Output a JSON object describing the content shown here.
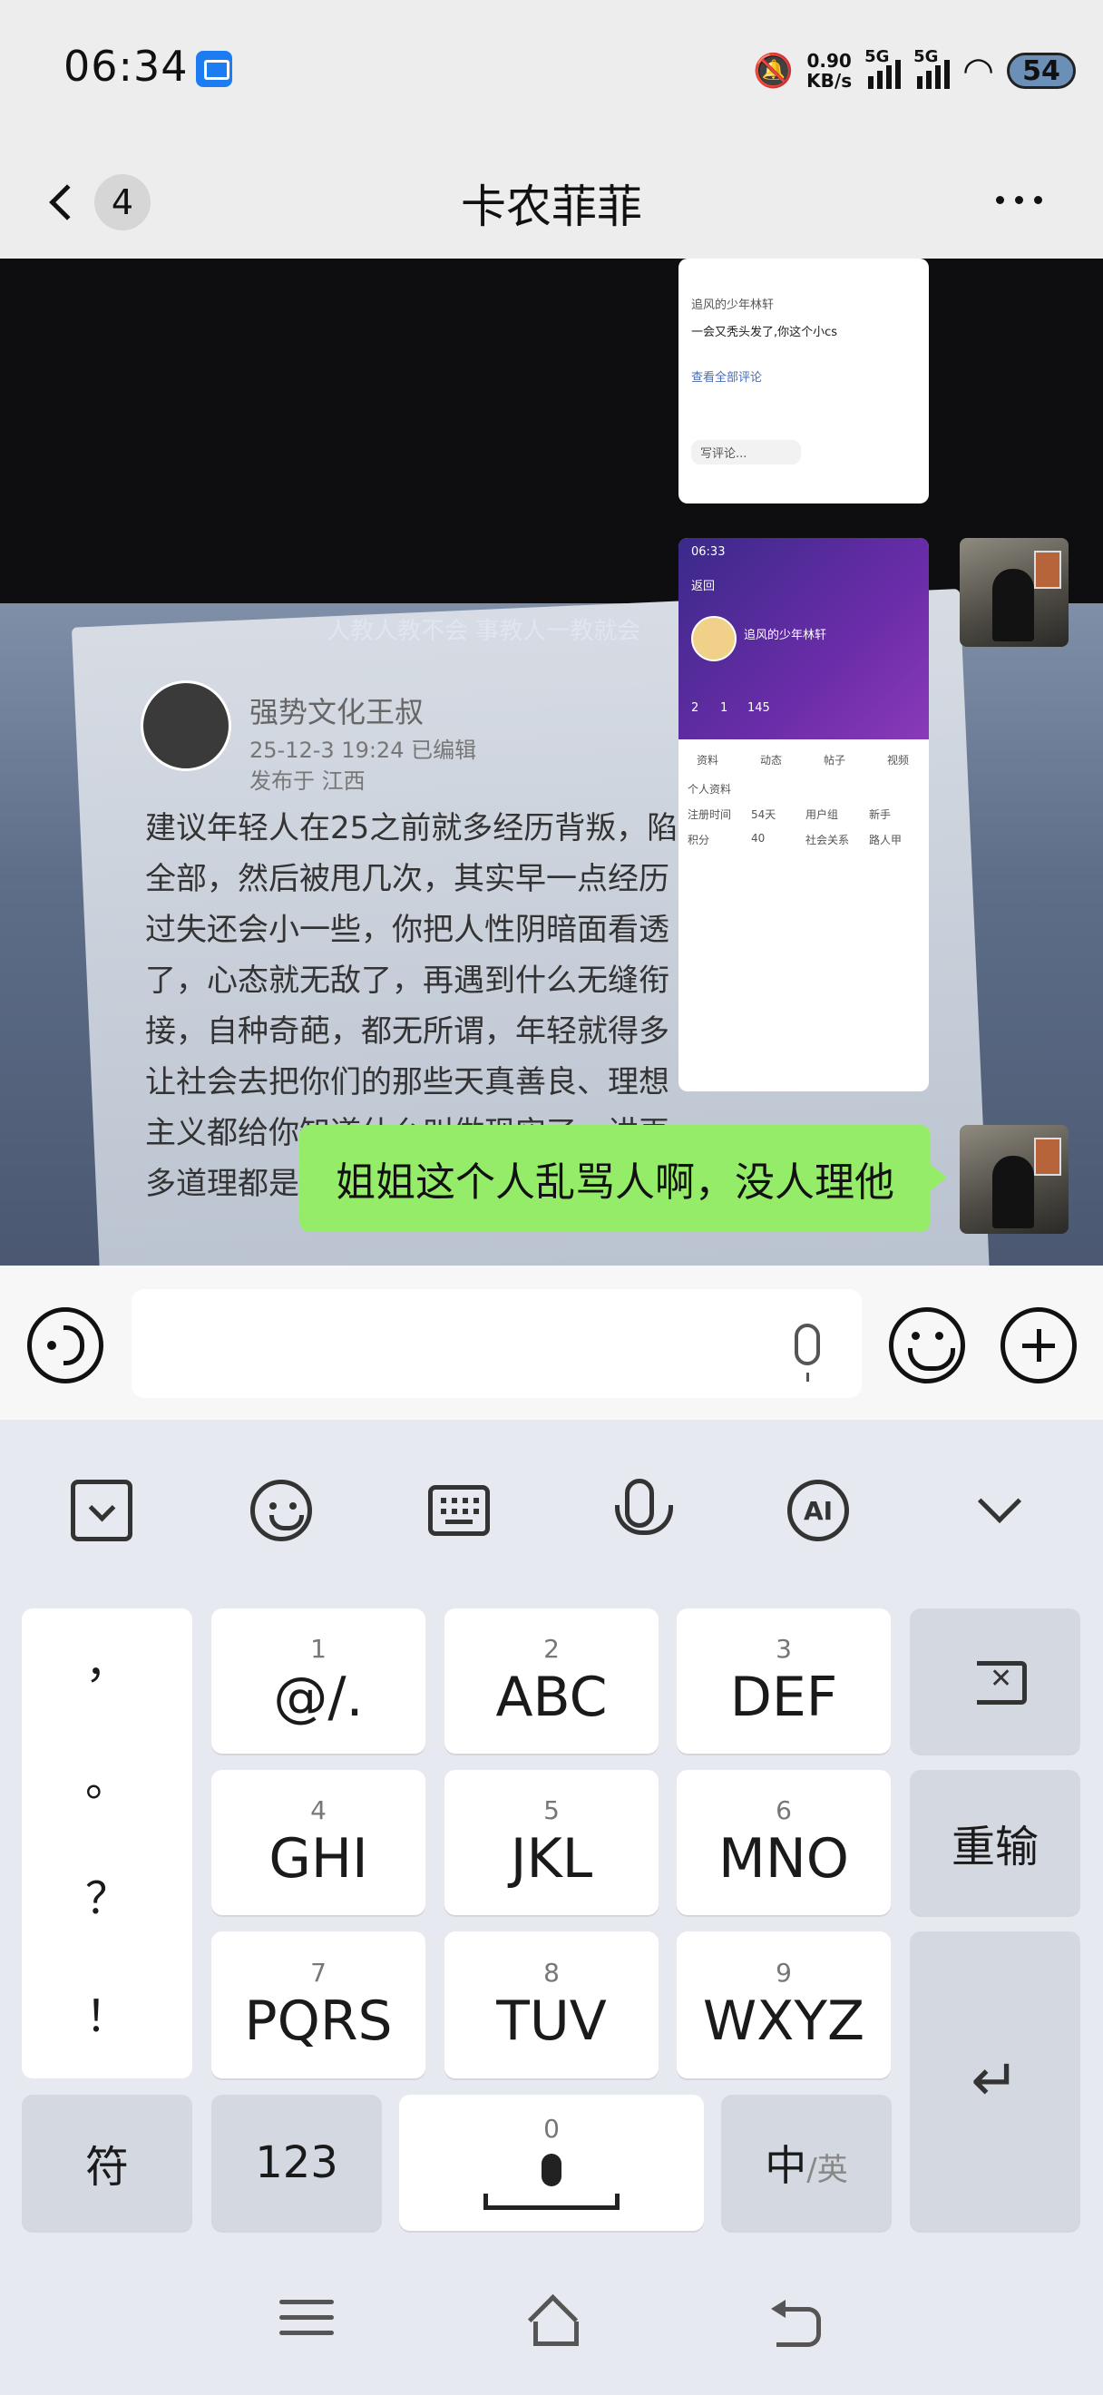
{
  "status_bar": {
    "time": "06:34",
    "net_speed_value": "0.90",
    "net_speed_unit": "KB/s",
    "sim1": "5G",
    "sim2": "5G",
    "battery": "54"
  },
  "header": {
    "unread_count": "4",
    "title": "卡农菲菲"
  },
  "messages": [
    {
      "type": "image",
      "sender": "self",
      "description_icon": "screenshot"
    },
    {
      "type": "image",
      "sender": "self",
      "description_icon": "screenshot"
    },
    {
      "type": "text",
      "sender": "self",
      "text": "姐姐这个人乱骂人啊，没人理他"
    }
  ],
  "background_photo": {
    "banner": "人教人教不会 事教人一教就会",
    "name": "强势文化王叔",
    "date": "25-12-3 19:24",
    "edited": "已编辑",
    "location": "发布于 江西",
    "body": "建议年轻人在25之前就多经历背叛，陷全部，然后被甩几次，其实早一点经历过失还会小一些，你把人性阴暗面看透了，心态就无敌了，再遇到什么无缝衔接，自种奇葩，都无所谓，年轻就得多让社会去把你们的那些天真善良、理想主义都给你知道什么叫做现实了，讲再多道理都是废狠的"
  },
  "screenshot1": {
    "user": "追风的少年林轩",
    "comment": "一会又秃头发了,你这个小cs",
    "view_more": "查看全部评论",
    "input_hint": "写评论..."
  },
  "screenshot2": {
    "time": "06:33",
    "back": "返回",
    "user": "追风的少年林轩",
    "stats": [
      "2",
      "1",
      "145"
    ],
    "tabs": [
      "资料",
      "动态",
      "帖子",
      "视频"
    ],
    "section": "个人资料",
    "fields": [
      "注册时间",
      "54天",
      "用户组",
      "新手",
      "积分",
      "40",
      "社会关系",
      "路人甲"
    ]
  },
  "input_bar": {
    "placeholder": ""
  },
  "keyboard": {
    "punctuation": [
      "，",
      "。",
      "？",
      "！"
    ],
    "keys": [
      {
        "num": "1",
        "label": "@/."
      },
      {
        "num": "2",
        "label": "ABC"
      },
      {
        "num": "3",
        "label": "DEF"
      },
      {
        "num": "4",
        "label": "GHI"
      },
      {
        "num": "5",
        "label": "JKL"
      },
      {
        "num": "6",
        "label": "MNO"
      },
      {
        "num": "7",
        "label": "PQRS"
      },
      {
        "num": "8",
        "label": "TUV"
      },
      {
        "num": "9",
        "label": "WXYZ"
      }
    ],
    "reset": "重输",
    "symbol": "符",
    "numeric": "123",
    "space_num": "0",
    "lang_main": "中",
    "lang_sub": "/英",
    "toolbar_ai": "AI"
  },
  "colors": {
    "bubble": "#95ec69",
    "header_bg": "#ededed",
    "keyboard_bg": "#e6e9ef"
  }
}
